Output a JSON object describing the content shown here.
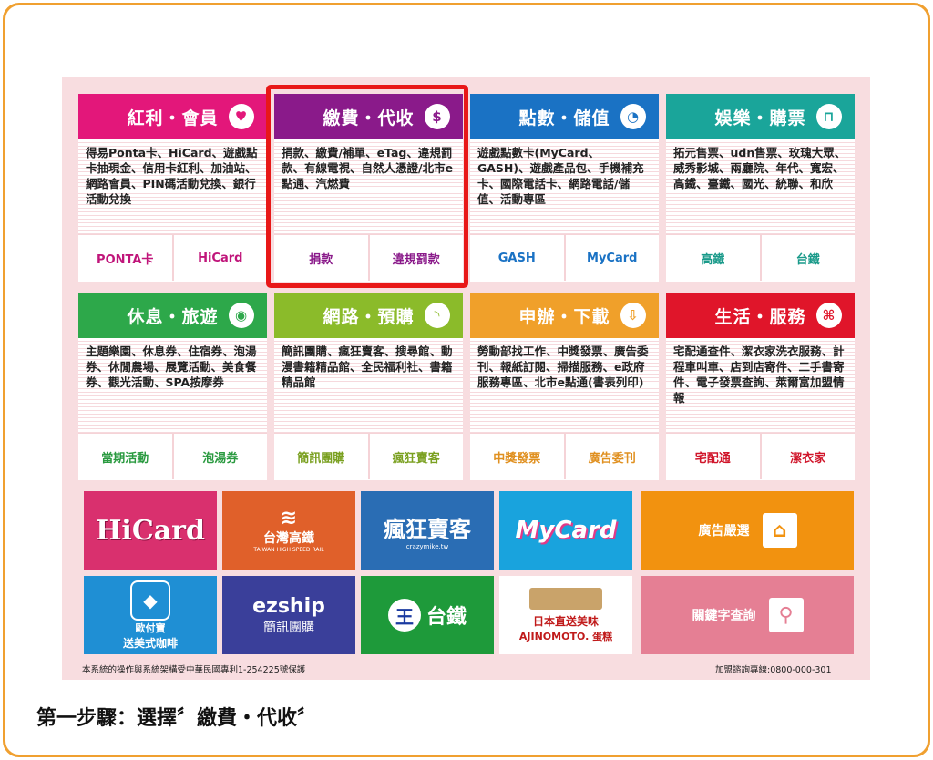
{
  "categories": [
    {
      "title": "紅利・會員",
      "icon": "heart-icon",
      "glyph": "♥",
      "color": "#e3177a",
      "desc": "得易Ponta卡、HiCard、遊戲點卡抽現金、信用卡紅利、加油站、網路會員、PIN碼活動兌換、銀行活動兌換",
      "links": [
        "PONTA卡",
        "HiCard"
      ],
      "link_color": "#c0157a"
    },
    {
      "title": "繳費・代收",
      "icon": "dollar-icon",
      "glyph": "$",
      "color": "#8a1a8a",
      "desc": "捐款、繳費/補單、eTag、違規罰款、有線電視、自然人憑證/北市e點通、汽燃費",
      "links": [
        "捐款",
        "違規罰款"
      ],
      "link_color": "#8a1a8a"
    },
    {
      "title": "點數・儲值",
      "icon": "pacman-icon",
      "glyph": "◔",
      "color": "#1a72c4",
      "desc": "遊戲點數卡(MyCard、GASH)、遊戲產品包、手機補充卡、國際電話卡、網路電話/儲值、活動專區",
      "links": [
        "GASH",
        "MyCard"
      ],
      "link_color": "#1a72c4"
    },
    {
      "title": "娛樂・購票",
      "icon": "basket-icon",
      "glyph": "⊓",
      "color": "#1aa59a",
      "desc": "拓元售票、udn售票、玫瑰大眾、威秀影城、兩廳院、年代、寬宏、高鐵、臺鐵、國光、統聯、和欣",
      "links": [
        "高鐵",
        "台鐵"
      ],
      "link_color": "#1a9a8a"
    },
    {
      "title": "休息・旅遊",
      "icon": "camera-icon",
      "glyph": "◉",
      "color": "#2da84a",
      "desc": "主題樂園、休息券、住宿券、泡湯券、休閒農場、展覽活動、美食餐券、觀光活動、SPA按摩券",
      "links": [
        "當期活動",
        "泡湯券"
      ],
      "link_color": "#2a9a40"
    },
    {
      "title": "網路・預購",
      "icon": "rss-icon",
      "glyph": "◝",
      "color": "#8bbb2a",
      "desc": "簡訊團購、瘋狂賣客、搜尋館、動漫書籍精品館、全民福利社、書籍精品館",
      "links": [
        "簡訊團購",
        "瘋狂賣客"
      ],
      "link_color": "#7aa020"
    },
    {
      "title": "申辦・下載",
      "icon": "download-icon",
      "glyph": "⇩",
      "color": "#f0a02a",
      "desc": "勞動部找工作、中獎發票、廣告委刊、報紙訂閱、掃描服務、e政府服務專區、北市e點通(書表列印)",
      "links": [
        "中獎發票",
        "廣告委刊"
      ],
      "link_color": "#e09020"
    },
    {
      "title": "生活・服務",
      "icon": "command-icon",
      "glyph": "⌘",
      "color": "#e0152a",
      "desc": "宅配通查件、潔衣家洗衣服務、計程車叫車、店到店寄件、二手書寄件、電子發票查詢、萊爾富加盟情報",
      "links": [
        "宅配通",
        "潔衣家"
      ],
      "link_color": "#d0152a"
    }
  ],
  "tiles": {
    "hicard": "HiCard",
    "thsr": "台灣高鐵",
    "thsr_en": "TAIWAN HIGH SPEED RAIL",
    "crazy": "瘋狂賣客",
    "crazy_sub": "crazymike.tw",
    "mycard": "MyCard",
    "ad_select": "廣告嚴選",
    "opay_name": "歐付寶",
    "opay_sub": "送美式咖啡",
    "ezship": "ezship",
    "ezship_sub": "簡訊團購",
    "tra": "台鐵",
    "ajinomoto_1": "日本直送美味",
    "ajinomoto_2": "AJINOMOTO. 蛋糕",
    "keyword": "關鍵字查詢"
  },
  "footer": {
    "left": "本系統的操作與系統架構受中華民國專利1-254225號保護",
    "right": "加盟諮詢專線:0800-000-301"
  },
  "caption": "第一步驟：選擇〞繳費・代收〞",
  "colors": {
    "frame": "#f0a030",
    "selection": "#e81818",
    "panel_bg": "#f8dde0"
  }
}
